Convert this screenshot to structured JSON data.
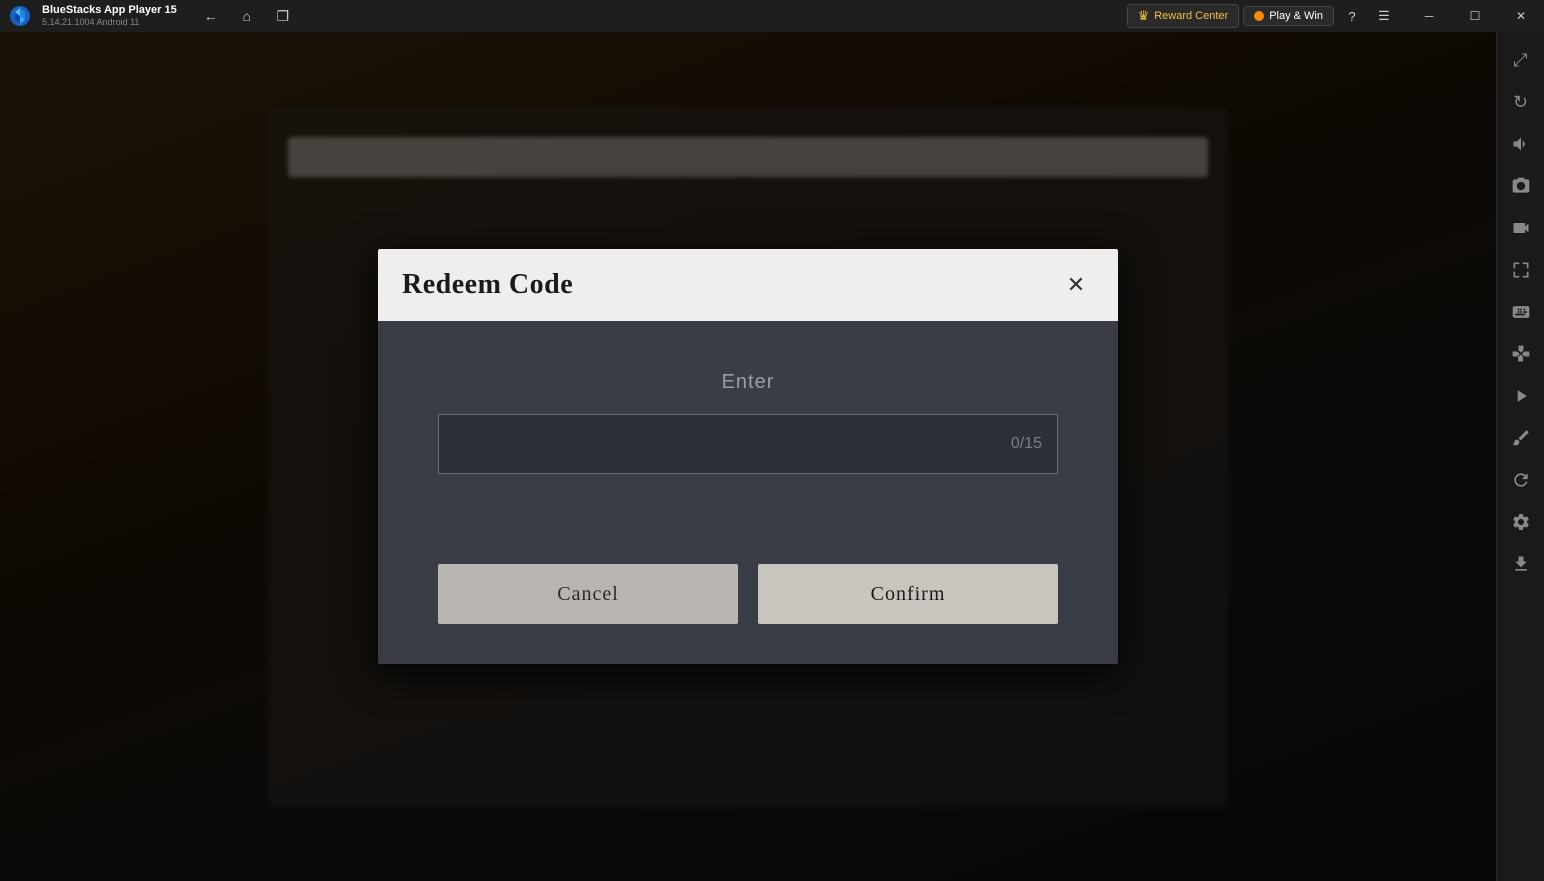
{
  "titlebar": {
    "app_name": "BlueStacks App Player 15",
    "version": "5.14.21.1004  Android 11",
    "nav_back_label": "←",
    "nav_home_label": "⌂",
    "nav_copy_label": "❐",
    "reward_center_label": "Reward Center",
    "play_win_label": "Play & Win",
    "help_label": "?",
    "menu_label": "☰",
    "minimize_label": "─",
    "maximize_label": "☐",
    "close_label": "✕",
    "restore_label": "❐"
  },
  "sidebar": {
    "icons": [
      {
        "name": "expand-icon",
        "symbol": "⤢"
      },
      {
        "name": "rotate-icon",
        "symbol": "↻"
      },
      {
        "name": "volume-icon",
        "symbol": "🔊"
      },
      {
        "name": "screenshot-icon",
        "symbol": "📷"
      },
      {
        "name": "camera-icon",
        "symbol": "🎥"
      },
      {
        "name": "resize-icon",
        "symbol": "⊞"
      },
      {
        "name": "keyboard-icon",
        "symbol": "⌨"
      },
      {
        "name": "gamepad-icon",
        "symbol": "🎮"
      },
      {
        "name": "macro-icon",
        "symbol": "▶"
      },
      {
        "name": "brush-icon",
        "symbol": "✏"
      },
      {
        "name": "refresh-icon",
        "symbol": "↺"
      },
      {
        "name": "settings-icon",
        "symbol": "⚙"
      },
      {
        "name": "download-icon",
        "symbol": "↓"
      }
    ]
  },
  "modal": {
    "title": "Redeem Code",
    "close_label": "✕",
    "enter_label": "Enter",
    "input_placeholder": "",
    "input_counter": "0/15",
    "input_max": 15,
    "input_current": 0,
    "cancel_label": "Cancel",
    "confirm_label": "Confirm"
  }
}
